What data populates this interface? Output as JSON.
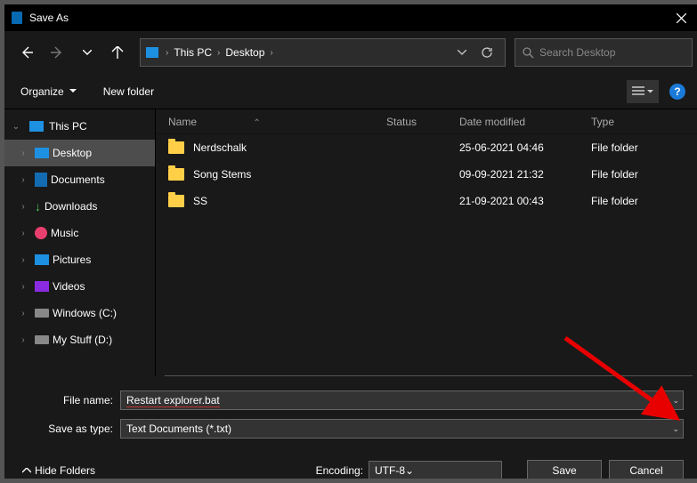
{
  "title": "Save As",
  "breadcrumb": {
    "root": "This PC",
    "leaf": "Desktop"
  },
  "search": {
    "placeholder": "Search Desktop"
  },
  "toolbar": {
    "organize": "Organize",
    "newfolder": "New folder"
  },
  "tree": {
    "root": "This PC",
    "items": [
      {
        "icon": "desktop",
        "label": "Desktop",
        "selected": true
      },
      {
        "icon": "doc",
        "label": "Documents"
      },
      {
        "icon": "dl",
        "label": "Downloads"
      },
      {
        "icon": "music",
        "label": "Music"
      },
      {
        "icon": "pic",
        "label": "Pictures"
      },
      {
        "icon": "vid",
        "label": "Videos"
      },
      {
        "icon": "drive",
        "label": "Windows (C:)"
      },
      {
        "icon": "drive",
        "label": "My Stuff (D:)"
      }
    ]
  },
  "columns": {
    "name": "Name",
    "status": "Status",
    "date": "Date modified",
    "type": "Type"
  },
  "files": [
    {
      "name": "Nerdschalk",
      "date": "25-06-2021 04:46",
      "type": "File folder"
    },
    {
      "name": "Song Stems",
      "date": "09-09-2021 21:32",
      "type": "File folder"
    },
    {
      "name": "SS",
      "date": "21-09-2021 00:43",
      "type": "File folder"
    }
  ],
  "form": {
    "filename_label": "File name:",
    "filename_value": "Restart explorer.bat",
    "saveastype_label": "Save as type:",
    "saveastype_value": "Text Documents (*.txt)",
    "encoding_label": "Encoding:",
    "encoding_value": "UTF-8",
    "hide_folders": "Hide Folders",
    "save": "Save",
    "cancel": "Cancel"
  }
}
